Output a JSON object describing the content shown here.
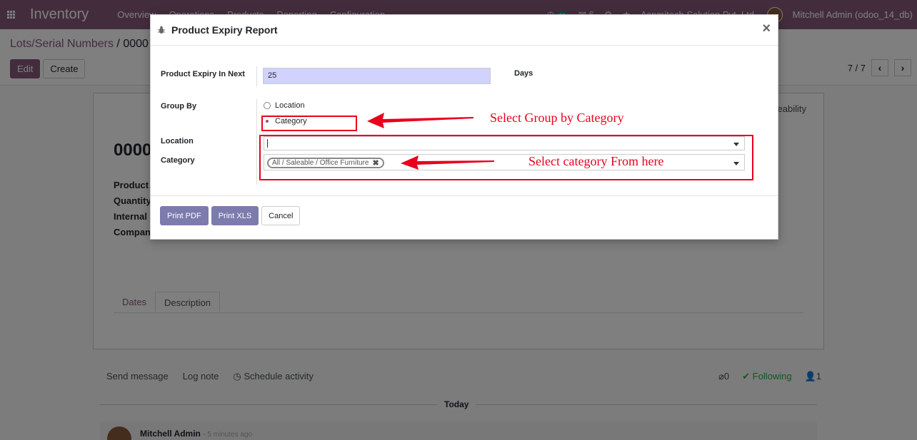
{
  "navbar": {
    "app_name": "Inventory",
    "menu": [
      "Overview",
      "Operations",
      "Products",
      "Reporting",
      "Configuration"
    ],
    "activity_count": "11",
    "message_count": "6",
    "company": "Aspmitech Solution Pvt. Ltd.",
    "user": "Mitchell Admin (odoo_14_db)"
  },
  "control_panel": {
    "breadcrumb_parent": "Lots/Serial Numbers",
    "breadcrumb_sep": "/",
    "breadcrumb_current": "0000",
    "edit_label": "Edit",
    "create_label": "Create",
    "pager": "7 / 7"
  },
  "sheet": {
    "traceability_label": "eability",
    "title": "0000",
    "fields": [
      "Product",
      "Quantity",
      "Internal R",
      "Company"
    ],
    "tabs": [
      "Dates",
      "Description"
    ]
  },
  "chatter": {
    "send_message": "Send message",
    "log_note": "Log note",
    "schedule_activity": "Schedule activity",
    "attachments": "0",
    "following": "Following",
    "followers": "1",
    "today": "Today",
    "author": "Mitchell Admin",
    "time": "- 5 minutes ago"
  },
  "modal": {
    "title": "Product Expiry Report",
    "close": "×",
    "expiry_label": "Product Expiry In Next",
    "expiry_value": "25",
    "days_label": "Days",
    "group_by_label": "Group By",
    "group_options": [
      "Location",
      "Category"
    ],
    "group_selected": "Category",
    "location_label": "Location",
    "category_label": "Category",
    "category_tag": "All / Saleable / Office Furniture",
    "print_pdf": "Print PDF",
    "print_xls": "Print XLS",
    "cancel": "Cancel"
  },
  "annotations": {
    "group_note": "Select Group by Category",
    "category_note": "Select category From here",
    "color": "#e8001e"
  },
  "colors": {
    "brand": "#875a7b",
    "primary_button": "#7c7bad",
    "input_highlight": "#d2d2ff"
  }
}
